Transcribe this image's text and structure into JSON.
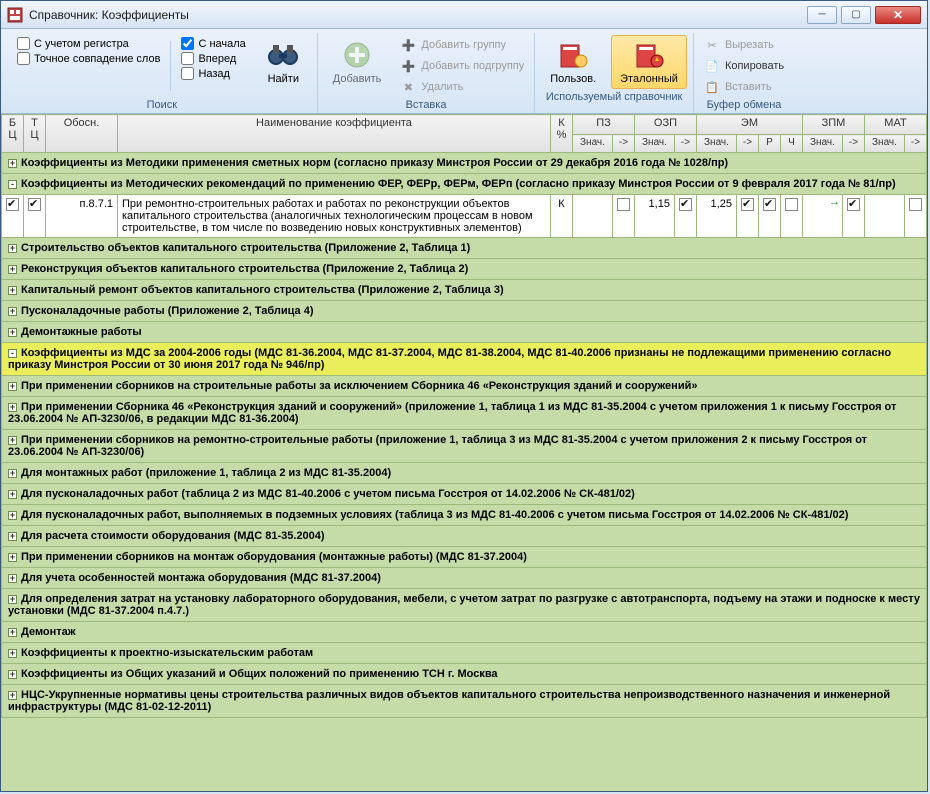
{
  "window": {
    "title": "Справочник: Коэффициенты"
  },
  "ribbon": {
    "search": {
      "opt_register": "С учетом регистра",
      "opt_exact": "Точное совпадение слов",
      "opt_begin": "С начала",
      "opt_forward": "Вперед",
      "opt_back": "Назад",
      "find": "Найти",
      "group": "Поиск"
    },
    "insert": {
      "add": "Добавить",
      "add_group": "Добавить группу",
      "add_subgroup": "Добавить подгруппу",
      "delete": "Удалить",
      "group": "Вставка"
    },
    "ref": {
      "user": "Пользов.",
      "etalon": "Эталонный",
      "group": "Используемый справочник"
    },
    "clipboard": {
      "cut": "Вырезать",
      "copy": "Копировать",
      "paste": "Вставить",
      "group": "Буфер обмена"
    }
  },
  "headers": {
    "bc": "Б Ц",
    "tc": "Т Ц",
    "obosn": "Обосн.",
    "name": "Наименование коэффициента",
    "kpct": "К %",
    "pz": "ПЗ",
    "ozp": "ОЗП",
    "em": "ЭМ",
    "zpm": "ЗПМ",
    "mat": "МАТ",
    "znach": "Знач.",
    "arrow": "->",
    "r": "Р",
    "ch": "Ч"
  },
  "ozp_val": "1,15",
  "em_val": "1,25",
  "row_obosn": "п.8.7.1",
  "row_text": "При ремонтно-строительных работах и работах по реконструкции объектов капитального строительства (аналогичных технологическим процессам в новом строительстве, в том числе по возведению новых конструктивных элементов)",
  "row_k": "К",
  "rows": [
    {
      "type": "green",
      "exp": "+",
      "text": "Коэффициенты из Методики применения сметных норм (согласно приказу Минстроя России от 29 декабря 2016 года № 1028/пр)"
    },
    {
      "type": "green",
      "exp": "-",
      "text": "Коэффициенты из Методических рекомендаций по применению ФЕР, ФЕРр, ФЕРм, ФЕРп (согласно приказу Минстроя России от 9 февраля 2017 года № 81/пр)"
    },
    {
      "type": "data"
    },
    {
      "type": "green",
      "exp": "+",
      "text": "Строительство объектов капитального строительства (Приложение 2, Таблица 1)"
    },
    {
      "type": "green",
      "exp": "+",
      "text": "Реконструкция объектов капитального строительства (Приложение 2, Таблица 2)"
    },
    {
      "type": "green",
      "exp": "+",
      "text": "Капитальный ремонт объектов капитального строительства (Приложение 2, Таблица 3)"
    },
    {
      "type": "green",
      "exp": "+",
      "text": "Пусконаладочные работы (Приложение 2, Таблица 4)"
    },
    {
      "type": "green",
      "exp": "+",
      "text": "Демонтажные работы"
    },
    {
      "type": "yellow",
      "exp": "-",
      "text": "Коэффициенты из МДС за 2004-2006 годы (МДС 81-36.2004, МДС 81-37.2004, МДС 81-38.2004, МДС 81-40.2006 признаны не подлежащими применению согласно приказу Минстроя России от 30 июня 2017 года № 946/пр)"
    },
    {
      "type": "green",
      "exp": "+",
      "text": "При применении сборников на строительные работы за исключением Сборника 46 «Реконструкция зданий и сооружений»"
    },
    {
      "type": "green",
      "exp": "+",
      "text": "При применении Сборника 46 «Реконструкция зданий и сооружений» (приложение 1, таблица 1 из МДС 81-35.2004 с учетом приложения 1 к письму Госстроя от 23.06.2004 № АП-3230/06, в редакции МДС 81-36.2004)"
    },
    {
      "type": "green",
      "exp": "+",
      "text": "При применении сборников на ремонтно-строительные работы (приложение 1, таблица 3 из МДС 81-35.2004 с учетом приложения 2 к письму Госстроя от 23.06.2004 № АП-3230/06)"
    },
    {
      "type": "green",
      "exp": "+",
      "text": "Для монтажных работ (приложение 1, таблица 2 из МДС 81-35.2004)"
    },
    {
      "type": "green",
      "exp": "+",
      "text": "Для пусконаладочных работ (таблица 2 из МДС 81-40.2006 с учетом письма Госстроя от 14.02.2006 № СК-481/02)"
    },
    {
      "type": "green",
      "exp": "+",
      "text": "Для пусконаладочных работ, выполняемых в подземных условиях (таблица 3 из МДС 81-40.2006 с учетом письма Госстроя от 14.02.2006 № СК-481/02)"
    },
    {
      "type": "green",
      "exp": "+",
      "text": "Для расчета стоимости оборудования (МДС 81-35.2004)"
    },
    {
      "type": "green",
      "exp": "+",
      "text": "При применении сборников на монтаж оборудования (монтажные работы) (МДС 81-37.2004)"
    },
    {
      "type": "green",
      "exp": "+",
      "text": "Для учета особенностей монтажа оборудования (МДС 81-37.2004)"
    },
    {
      "type": "green",
      "exp": "+",
      "text": "Для определения затрат на установку лабораторного оборудования, мебели, с учетом затрат по разгрузке с автотранспорта, подъему на этажи и подноске к месту установки (МДС 81-37.2004 п.4.7.)"
    },
    {
      "type": "green",
      "exp": "+",
      "text": "Демонтаж"
    },
    {
      "type": "green",
      "exp": "+",
      "text": "Коэффициенты к проектно-изыскательским работам"
    },
    {
      "type": "green",
      "exp": "+",
      "text": "Коэффициенты из Общих указаний и Общих положений по применению ТСН г. Москва"
    },
    {
      "type": "green",
      "exp": "+",
      "text": "НЦС-Укрупненные нормативы цены строительства различных видов объектов капитального строительства непроизводственного назначения и инженерной инфраструктуры (МДС 81-02-12-2011)"
    }
  ]
}
